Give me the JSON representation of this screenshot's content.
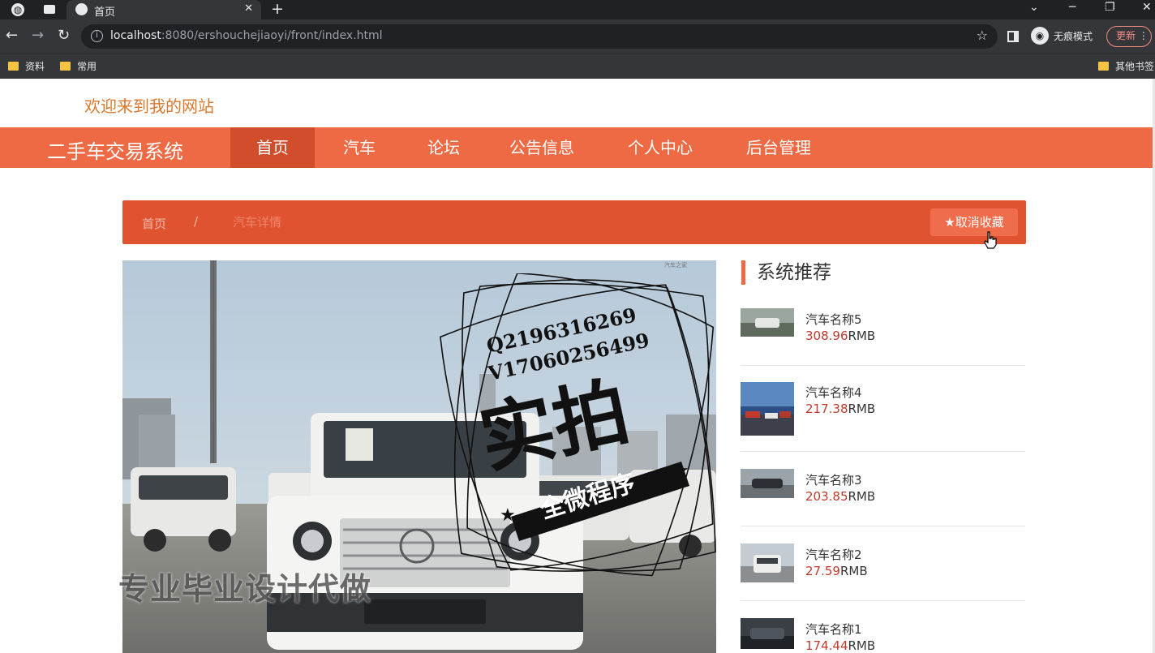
{
  "browser": {
    "tab_title": "首页",
    "url_host": "localhost",
    "url_rest": ":8080/ershouchejiaoyi/front/index.html",
    "incognito_label": "无痕模式",
    "update_label": "更新",
    "bookmarks": [
      "资料",
      "常用",
      "其他书签"
    ]
  },
  "site": {
    "welcome": "欢迎来到我的网站",
    "brand": "二手车交易系统",
    "nav": [
      "首页",
      "汽车",
      "论坛",
      "公告信息",
      "个人中心",
      "后台管理"
    ],
    "active_nav": "首页"
  },
  "breadcrumb": {
    "home": "首页",
    "separator": "/",
    "current": "汽车详情"
  },
  "actions": {
    "favorite_label": "★取消收藏"
  },
  "recommend": {
    "title": "系统推荐",
    "unit": "RMB",
    "items": [
      {
        "name": "汽车名称5",
        "price": "308.96"
      },
      {
        "name": "汽车名称4",
        "price": "217.38"
      },
      {
        "name": "汽车名称3",
        "price": "203.85"
      },
      {
        "name": "汽车名称2",
        "price": "27.59"
      },
      {
        "name": "汽车名称1",
        "price": "174.44"
      }
    ]
  },
  "overlay": {
    "contact_q": "Q2196316269",
    "contact_v": "V17060256499",
    "stamp_big": "实拍",
    "stamp_ribbon": "全微程序",
    "bottom_watermark": "专业毕业设计代做"
  },
  "colors": {
    "navbar": "#ee6a44",
    "nav_active": "#d14d2c",
    "crumbbar": "#df5331",
    "price": "#c0392b",
    "welcome": "#d9782f"
  }
}
